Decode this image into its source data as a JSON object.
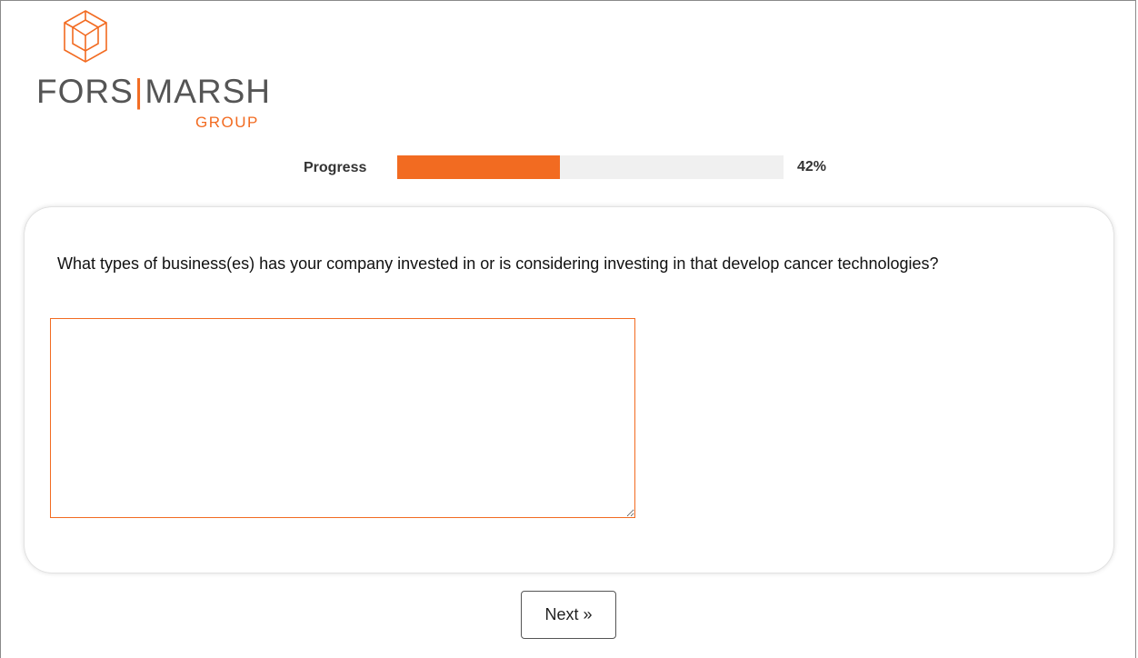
{
  "logo": {
    "main_left": "FORS",
    "separator": "|",
    "main_right": "MARSH",
    "sub": "GROUP",
    "icon": "cube-logo-icon"
  },
  "progress": {
    "label": "Progress",
    "percent": 42,
    "percent_text": "42%"
  },
  "question": {
    "text": "What types of business(es) has your company invested in or is considering investing in that develop cancer technologies?",
    "answer_value": ""
  },
  "nav": {
    "next_label": "Next »"
  },
  "colors": {
    "accent": "#f26b21",
    "logo_gray": "#555555",
    "track": "#f0f0f0"
  }
}
